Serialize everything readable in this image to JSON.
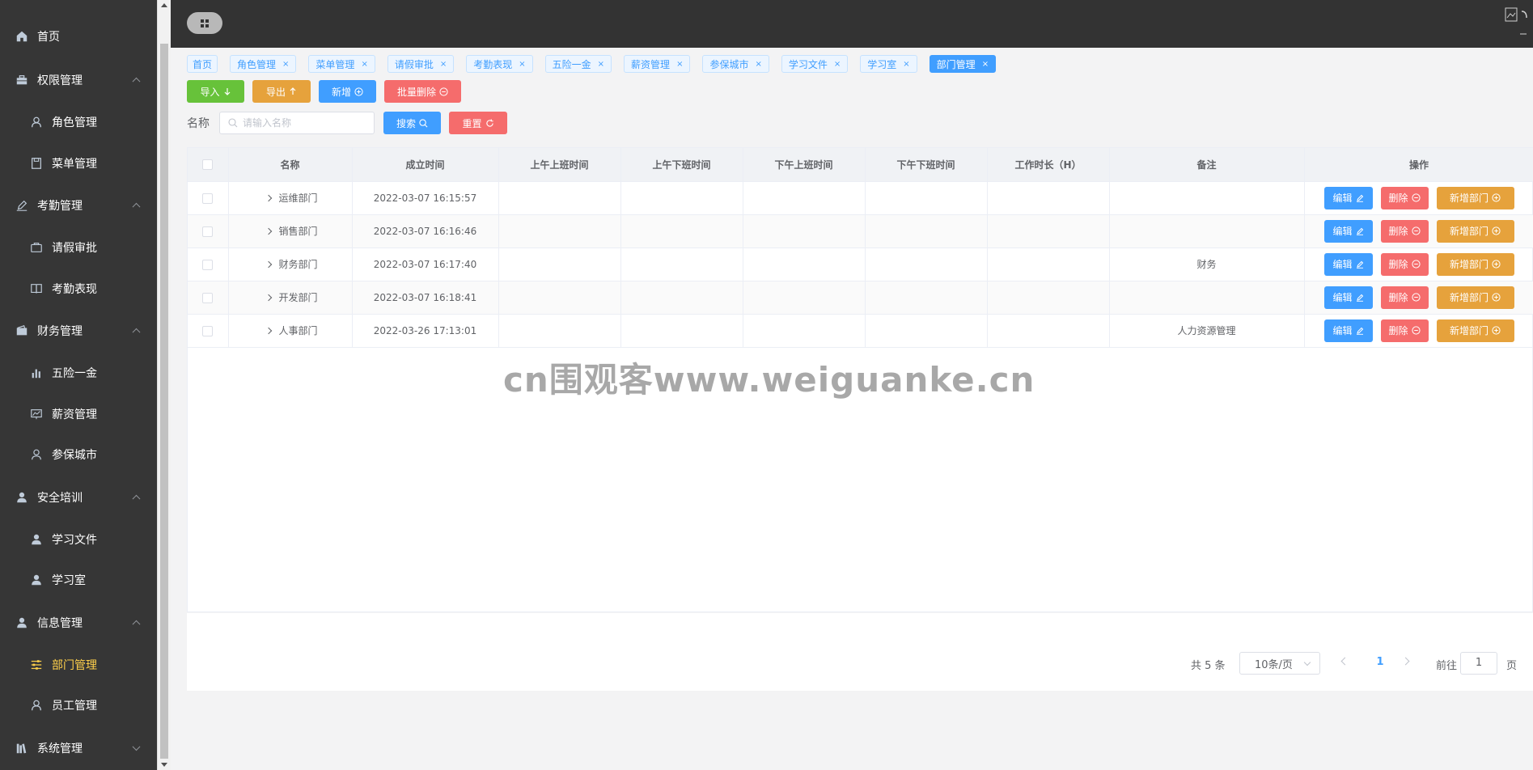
{
  "sidebar": {
    "items": [
      {
        "label": "首页",
        "icon": "home-icon",
        "level": 0,
        "arrow": "none",
        "active": false
      },
      {
        "label": "权限管理",
        "icon": "briefcase-icon",
        "level": 0,
        "arrow": "up",
        "active": false
      },
      {
        "label": "角色管理",
        "icon": "user-icon",
        "level": 1,
        "arrow": "none",
        "active": false
      },
      {
        "label": "菜单管理",
        "icon": "save-icon",
        "level": 1,
        "arrow": "none",
        "active": false
      },
      {
        "label": "考勤管理",
        "icon": "edit-icon",
        "level": 0,
        "arrow": "up",
        "active": false
      },
      {
        "label": "请假审批",
        "icon": "suitcase-icon",
        "level": 1,
        "arrow": "none",
        "active": false
      },
      {
        "label": "考勤表现",
        "icon": "reading-icon",
        "level": 1,
        "arrow": "none",
        "active": false
      },
      {
        "label": "财务管理",
        "icon": "wallet-icon",
        "level": 0,
        "arrow": "up",
        "active": false
      },
      {
        "label": "五险一金",
        "icon": "bar-chart-icon",
        "level": 1,
        "arrow": "none",
        "active": false
      },
      {
        "label": "薪资管理",
        "icon": "data-line-icon",
        "level": 1,
        "arrow": "none",
        "active": false
      },
      {
        "label": "参保城市",
        "icon": "location-icon",
        "level": 1,
        "arrow": "none",
        "active": false
      },
      {
        "label": "安全培训",
        "icon": "user-solid-icon",
        "level": 0,
        "arrow": "up",
        "active": false
      },
      {
        "label": "学习文件",
        "icon": "user-solid-icon",
        "level": 1,
        "arrow": "none",
        "active": false
      },
      {
        "label": "学习室",
        "icon": "user-solid-icon",
        "level": 1,
        "arrow": "none",
        "active": false
      },
      {
        "label": "信息管理",
        "icon": "user-solid-icon",
        "level": 0,
        "arrow": "up",
        "active": false
      },
      {
        "label": "部门管理",
        "icon": "sliders-icon",
        "level": 1,
        "arrow": "none",
        "active": true
      },
      {
        "label": "员工管理",
        "icon": "user-icon",
        "level": 1,
        "arrow": "none",
        "active": false
      },
      {
        "label": "系统管理",
        "icon": "books-icon",
        "level": 0,
        "arrow": "down",
        "active": false
      }
    ]
  },
  "header": {
    "toggle_icon": "grid-icon"
  },
  "tags": [
    {
      "label": "首页",
      "closable": false,
      "active": false
    },
    {
      "label": "角色管理",
      "closable": true,
      "active": false
    },
    {
      "label": "菜单管理",
      "closable": true,
      "active": false
    },
    {
      "label": "请假审批",
      "closable": true,
      "active": false
    },
    {
      "label": "考勤表现",
      "closable": true,
      "active": false
    },
    {
      "label": "五险一金",
      "closable": true,
      "active": false
    },
    {
      "label": "薪资管理",
      "closable": true,
      "active": false
    },
    {
      "label": "参保城市",
      "closable": true,
      "active": false
    },
    {
      "label": "学习文件",
      "closable": true,
      "active": false
    },
    {
      "label": "学习室",
      "closable": true,
      "active": false
    },
    {
      "label": "部门管理",
      "closable": true,
      "active": true
    }
  ],
  "toolbar": {
    "import_label": "导入",
    "export_label": "导出",
    "add_label": "新增",
    "batch_delete_label": "批量删除"
  },
  "search": {
    "label": "名称",
    "placeholder": "请输入名称",
    "search_label": "搜索",
    "reset_label": "重置"
  },
  "table": {
    "columns": [
      "名称",
      "成立时间",
      "上午上班时间",
      "上午下班时间",
      "下午上班时间",
      "下午下班时间",
      "工作时长（H）",
      "备注",
      "操作"
    ],
    "rows": [
      {
        "name": "运维部门",
        "founded": "2022-03-07 16:15:57",
        "am_in": "",
        "am_out": "",
        "pm_in": "",
        "pm_out": "",
        "hours": "",
        "remark": ""
      },
      {
        "name": "销售部门",
        "founded": "2022-03-07 16:16:46",
        "am_in": "",
        "am_out": "",
        "pm_in": "",
        "pm_out": "",
        "hours": "",
        "remark": ""
      },
      {
        "name": "财务部门",
        "founded": "2022-03-07 16:17:40",
        "am_in": "",
        "am_out": "",
        "pm_in": "",
        "pm_out": "",
        "hours": "",
        "remark": "财务"
      },
      {
        "name": "开发部门",
        "founded": "2022-03-07 16:18:41",
        "am_in": "",
        "am_out": "",
        "pm_in": "",
        "pm_out": "",
        "hours": "",
        "remark": ""
      },
      {
        "name": "人事部门",
        "founded": "2022-03-26 17:13:01",
        "am_in": "",
        "am_out": "",
        "pm_in": "",
        "pm_out": "",
        "hours": "",
        "remark": "人力资源管理"
      }
    ],
    "row_actions": {
      "edit_label": "编辑",
      "delete_label": "删除",
      "add_dept_label": "新增部门"
    }
  },
  "watermark": "cn围观客www.weiguanke.cn",
  "pagination": {
    "total": "共 5 条",
    "page_size": "10条/页",
    "current_page": "1",
    "goto_label": "前往",
    "goto_value": "1",
    "page_suffix": "页"
  },
  "colors": {
    "primary": "#409eff",
    "success": "#67c23a",
    "warning": "#e6a23c",
    "danger": "#f56c6c",
    "sidebar_bg": "#363636",
    "header_bg": "#333333",
    "active_menu": "#ffd04b"
  }
}
